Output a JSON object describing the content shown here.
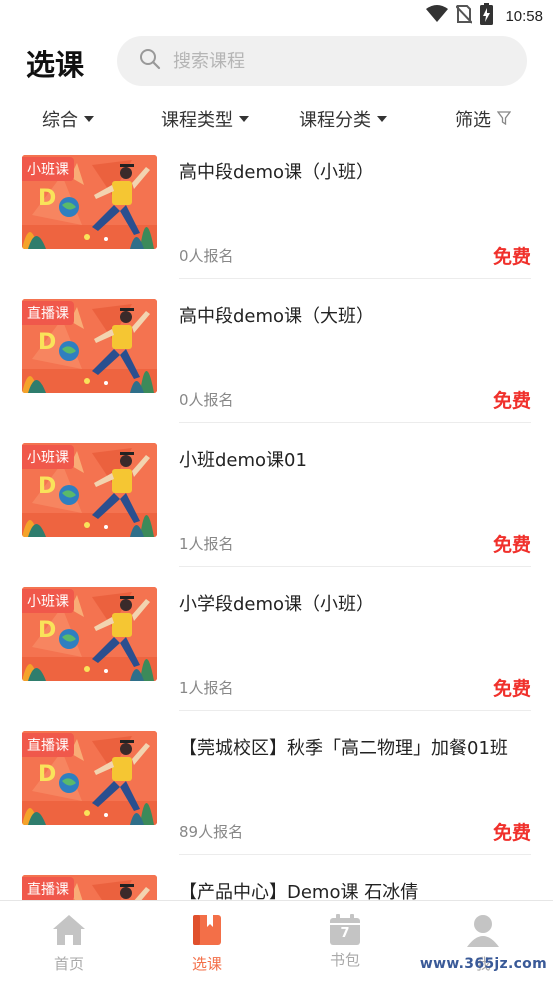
{
  "status_bar": {
    "time": "10:58",
    "icons": [
      "wifi-icon",
      "no-sim-icon",
      "battery-charging-icon"
    ]
  },
  "header": {
    "title": "选课",
    "search_placeholder": "搜索课程"
  },
  "filters": [
    {
      "label": "综合",
      "icon": "caret-down-icon"
    },
    {
      "label": "课程类型",
      "icon": "caret-down-icon"
    },
    {
      "label": "课程分类",
      "icon": "caret-down-icon"
    },
    {
      "label": "筛选",
      "icon": "filter-icon"
    }
  ],
  "courses": [
    {
      "badge": "小班课",
      "title": "高中段demo课（小班）",
      "enrolled": "0人报名",
      "price": "免费"
    },
    {
      "badge": "直播课",
      "title": "高中段demo课（大班）",
      "enrolled": "0人报名",
      "price": "免费"
    },
    {
      "badge": "小班课",
      "title": "小班demo课01",
      "enrolled": "1人报名",
      "price": "免费"
    },
    {
      "badge": "小班课",
      "title": "小学段demo课（小班）",
      "enrolled": "1人报名",
      "price": "免费"
    },
    {
      "badge": "直播课",
      "title": "【莞城校区】秋季「高二物理」加餐01班",
      "enrolled": "89人报名",
      "price": "免费"
    },
    {
      "badge": "直播课",
      "title": "【产品中心】Demo课 石冰倩",
      "enrolled": "",
      "price": ""
    }
  ],
  "bottom_nav": [
    {
      "label": "首页",
      "icon": "home-icon",
      "active": false
    },
    {
      "label": "选课",
      "icon": "book-icon",
      "active": true
    },
    {
      "label": "书包",
      "icon": "calendar-icon",
      "active": false,
      "calendar_day": "7"
    },
    {
      "label": "我",
      "icon": "user-icon",
      "active": false
    }
  ],
  "watermark": "www.365jz.com",
  "colors": {
    "accent": "#f36f48",
    "price": "#f0302b",
    "badge": "#f0584b"
  }
}
